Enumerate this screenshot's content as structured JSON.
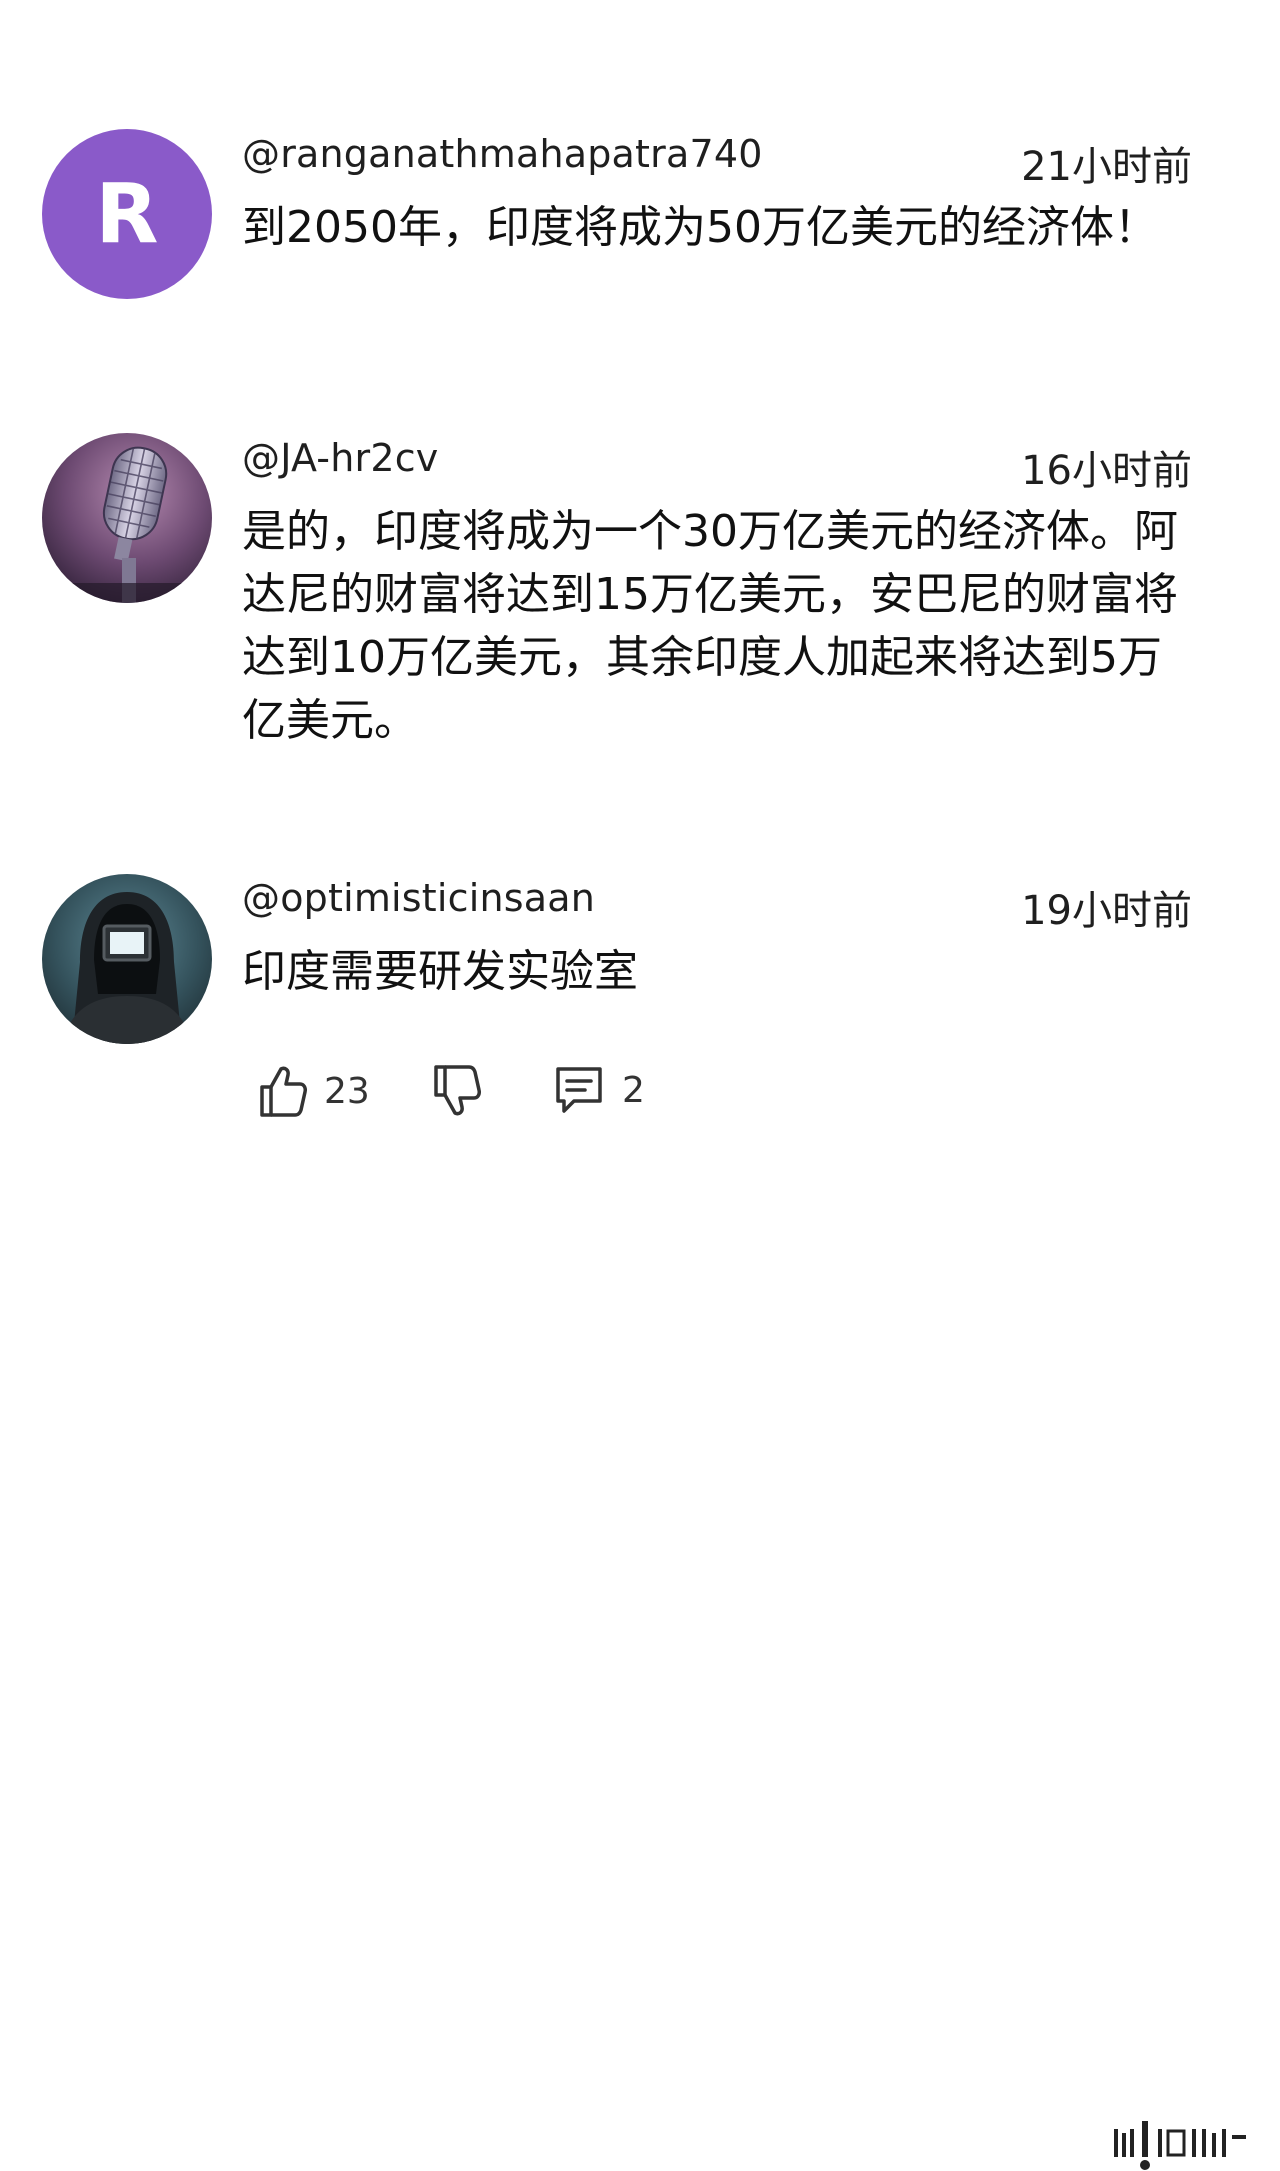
{
  "comments": [
    {
      "avatar_letter": "R",
      "avatar_color": "#8a5ac9",
      "handle": "@ranganathmahapatra740",
      "time": "21小时前",
      "text": "到2050年，印度将成为50万亿美元的经济体！"
    },
    {
      "avatar_icon": "microphone-avatar",
      "handle": "@JA-hr2cv",
      "time": "16小时前",
      "text": "是的，印度将成为一个30万亿美元的经济体。阿达尼的财富将达到15万亿美元，安巴尼的财富将达到10万亿美元，其余印度人加起来将达到5万亿美元。"
    },
    {
      "avatar_icon": "hooded-figure-avatar",
      "handle": "@optimisticinsaan",
      "time": "19小时前",
      "text": "印度需要研发实验室"
    }
  ],
  "actions": {
    "like_icon": "thumbs-up-icon",
    "like_count": "23",
    "dislike_icon": "thumbs-down-icon",
    "reply_icon": "comment-icon",
    "reply_count": "2"
  },
  "colors": {
    "avatar_purple": "#8a5ac9",
    "text": "#111111"
  }
}
